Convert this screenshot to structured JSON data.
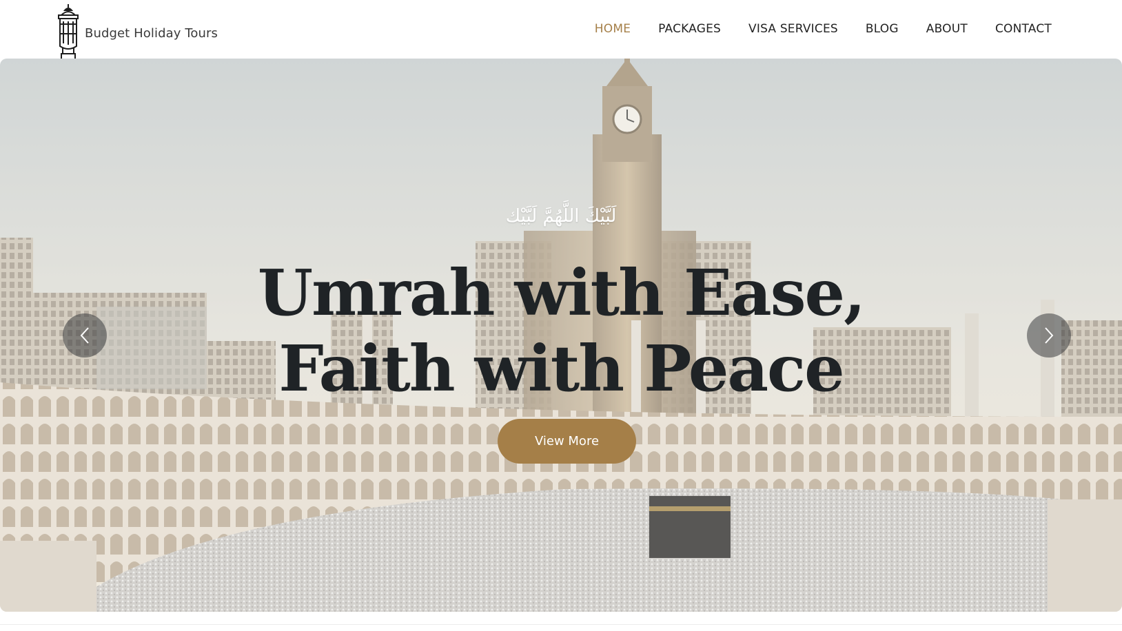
{
  "brand": {
    "name": "Budget Holiday Tours",
    "logo_icon": "lantern-icon"
  },
  "nav": {
    "items": [
      {
        "label": "HOME",
        "active": true
      },
      {
        "label": "PACKAGES",
        "active": false
      },
      {
        "label": "VISA SERVICES",
        "active": false
      },
      {
        "label": "BLOG",
        "active": false
      },
      {
        "label": "ABOUT",
        "active": false
      },
      {
        "label": "CONTACT",
        "active": false
      }
    ]
  },
  "hero": {
    "arabic_text": "لَبَّيْكَ اللَّهُمَّ لَبَّيْك",
    "headline_line1": "Umrah with Ease,",
    "headline_line2": "Faith with Peace",
    "cta_label": "View More",
    "prev_icon": "chevron-left-icon",
    "next_icon": "chevron-right-icon"
  },
  "colors": {
    "accent": "#a57f48",
    "text_dark": "#1f2326",
    "nav_text": "#222222"
  }
}
